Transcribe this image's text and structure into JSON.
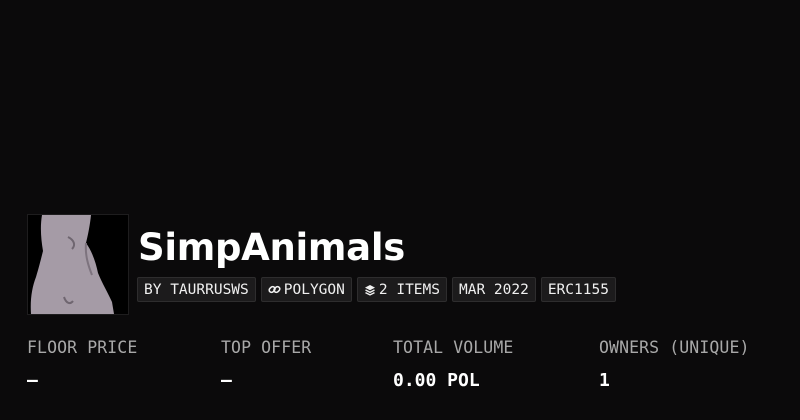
{
  "collection": {
    "name": "SimpAnimals",
    "avatar_alt": "collection-avatar",
    "tags": [
      {
        "text": "BY TAURRUSWS",
        "icon": ""
      },
      {
        "text": "POLYGON",
        "icon": "link-icon"
      },
      {
        "text": "2 ITEMS",
        "icon": "layers-icon"
      },
      {
        "text": "MAR 2022",
        "icon": ""
      },
      {
        "text": "ERC1155",
        "icon": ""
      }
    ]
  },
  "stats": [
    {
      "label": "FLOOR PRICE",
      "value": "—"
    },
    {
      "label": "TOP OFFER",
      "value": "—"
    },
    {
      "label": "TOTAL VOLUME",
      "value": "0.00 POL"
    },
    {
      "label": "OWNERS (UNIQUE)",
      "value": "1"
    }
  ],
  "colors": {
    "background": "#0b0a0b",
    "tag_background": "#1c1b1c",
    "label_gray": "#a8a8a8",
    "avatar_figure": "#a59ba6"
  }
}
